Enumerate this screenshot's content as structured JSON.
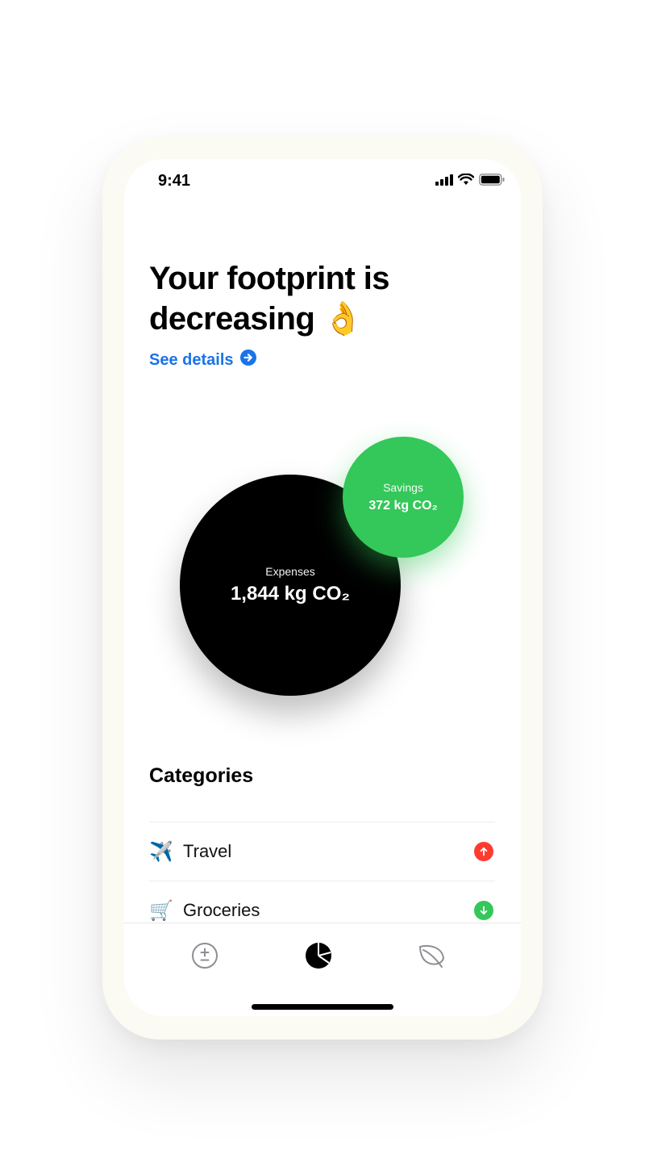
{
  "status_bar": {
    "time": "9:41",
    "signal_icon": "cellular-signal-icon",
    "wifi_icon": "wifi-icon",
    "battery_icon": "battery-icon"
  },
  "headline": {
    "line1": "Your footprint is",
    "line2": "decreasing",
    "emoji": "👌"
  },
  "see_details": {
    "label": "See details",
    "icon": "arrow-right-circle-icon"
  },
  "expenses": {
    "label": "Expenses",
    "value": "1,844 kg CO₂"
  },
  "savings": {
    "label": "Savings",
    "value": "372 kg CO₂"
  },
  "categories": {
    "title": "Categories",
    "items": [
      {
        "emoji": "✈️",
        "label": "Travel",
        "trend": "up",
        "trend_icon": "arrow-up-icon",
        "color": "#ff3b30"
      },
      {
        "emoji": "🛒",
        "label": "Groceries",
        "trend": "down",
        "trend_icon": "arrow-down-icon",
        "color": "#34c759"
      }
    ]
  },
  "tab_bar": {
    "tabs": [
      {
        "icon": "plus-minus-icon",
        "active": false
      },
      {
        "icon": "pie-chart-icon",
        "active": true
      },
      {
        "icon": "leaf-icon",
        "active": false
      }
    ]
  },
  "colors": {
    "accent": "#1a73e8",
    "savings_green": "#34c759",
    "expenses_black": "#000000",
    "trend_up": "#ff3b30",
    "trend_down": "#34c759"
  }
}
